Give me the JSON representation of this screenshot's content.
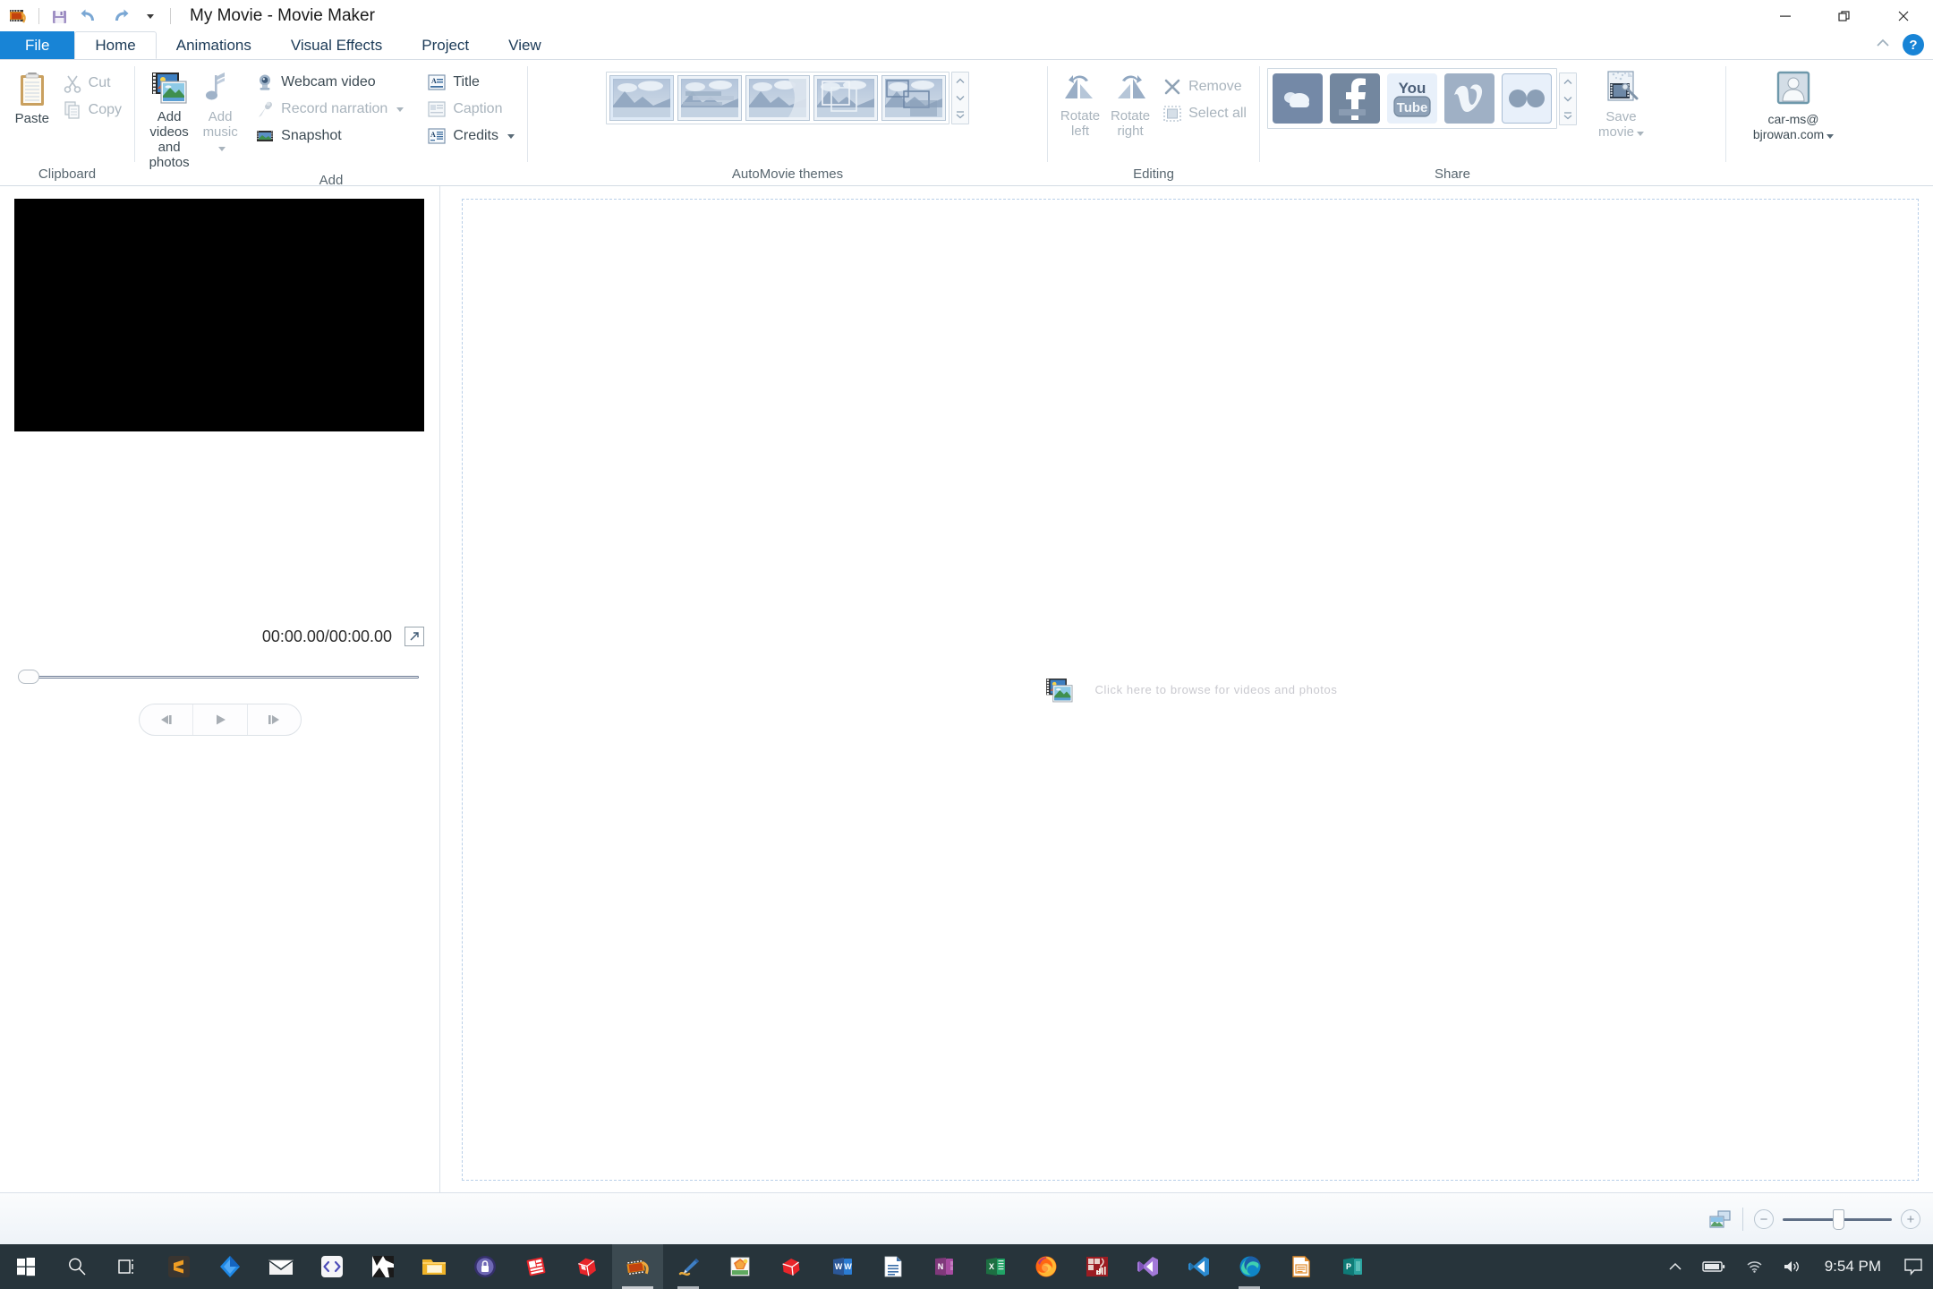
{
  "window": {
    "title": "My Movie - Movie Maker",
    "app_icon": "movie-maker-icon",
    "quick_access": [
      {
        "name": "save-icon",
        "label": "Save"
      },
      {
        "name": "undo-icon",
        "label": "Undo"
      },
      {
        "name": "redo-icon",
        "label": "Redo"
      },
      {
        "name": "customize-qat-icon",
        "label": "Customize Quick Access Toolbar"
      }
    ],
    "controls": [
      {
        "name": "minimize-button",
        "label": "Minimize",
        "glyph": "minimize"
      },
      {
        "name": "restore-button",
        "label": "Restore",
        "glyph": "restore"
      },
      {
        "name": "close-button",
        "label": "Close",
        "glyph": "close"
      }
    ]
  },
  "tabs": [
    {
      "label": "File",
      "kind": "file"
    },
    {
      "label": "Home",
      "kind": "active"
    },
    {
      "label": "Animations",
      "kind": "normal"
    },
    {
      "label": "Visual Effects",
      "kind": "normal"
    },
    {
      "label": "Project",
      "kind": "normal"
    },
    {
      "label": "View",
      "kind": "normal"
    }
  ],
  "tabstrip_right": {
    "collapse_label": "Minimize the Ribbon",
    "help_label": "?"
  },
  "ribbon": {
    "groups": [
      {
        "id": "clipboard",
        "label": "Clipboard",
        "big": [
          {
            "name": "paste-button",
            "label": "Paste",
            "icon": "clipboard-icon",
            "disabled": false
          }
        ],
        "small": [
          {
            "name": "cut-button",
            "label": "Cut",
            "icon": "scissors-icon",
            "disabled": true
          },
          {
            "name": "copy-button",
            "label": "Copy",
            "icon": "copy-icon",
            "disabled": true
          }
        ]
      },
      {
        "id": "add",
        "label": "Add",
        "big": [
          {
            "name": "add-videos-and-photos-button",
            "label1": "Add videos",
            "label2": "and photos",
            "icon": "add-media-icon",
            "disabled": false
          },
          {
            "name": "add-music-button",
            "label1": "Add",
            "label2": "music",
            "icon": "music-note-icon",
            "disabled": true,
            "caret": true
          }
        ],
        "small": [
          {
            "name": "webcam-video-button",
            "label": "Webcam video",
            "icon": "webcam-icon",
            "disabled": false
          },
          {
            "name": "record-narration-button",
            "label": "Record narration",
            "icon": "microphone-icon",
            "disabled": true,
            "caret": true
          },
          {
            "name": "snapshot-button",
            "label": "Snapshot",
            "icon": "snapshot-icon",
            "disabled": false
          }
        ],
        "small2": [
          {
            "name": "title-button",
            "label": "Title",
            "icon": "title-icon",
            "disabled": false
          },
          {
            "name": "caption-button",
            "label": "Caption",
            "icon": "caption-icon",
            "disabled": true
          },
          {
            "name": "credits-button",
            "label": "Credits",
            "icon": "credits-icon",
            "disabled": false,
            "caret": true
          }
        ]
      },
      {
        "id": "automovie-themes",
        "label": "AutoMovie themes",
        "themes": [
          {
            "name": "theme-no-theme",
            "label": "No theme",
            "style": "plain"
          },
          {
            "name": "theme-default",
            "label": "Default",
            "style": "bars"
          },
          {
            "name": "theme-contemporary",
            "label": "Contemporary",
            "style": "curve"
          },
          {
            "name": "theme-cinematic",
            "label": "Cinematic",
            "style": "frames"
          },
          {
            "name": "theme-fade",
            "label": "Fade",
            "style": "boxes"
          }
        ],
        "scroll": [
          {
            "name": "gallery-scroll-up-button",
            "glyph": "up"
          },
          {
            "name": "gallery-scroll-down-button",
            "glyph": "down"
          },
          {
            "name": "gallery-more-button",
            "glyph": "more"
          }
        ]
      },
      {
        "id": "editing",
        "label": "Editing",
        "big": [
          {
            "name": "rotate-left-button",
            "label1": "Rotate",
            "label2": "left",
            "icon": "rotate-left-icon",
            "disabled": true
          },
          {
            "name": "rotate-right-button",
            "label1": "Rotate",
            "label2": "right",
            "icon": "rotate-right-icon",
            "disabled": true
          }
        ],
        "small": [
          {
            "name": "remove-button",
            "label": "Remove",
            "icon": "remove-x-icon",
            "disabled": true
          },
          {
            "name": "select-all-button",
            "label": "Select all",
            "icon": "select-all-icon",
            "disabled": true
          }
        ]
      },
      {
        "id": "share",
        "label": "Share",
        "services": [
          {
            "name": "onedrive-share-button",
            "label": "OneDrive",
            "style": "onedrive"
          },
          {
            "name": "facebook-share-button",
            "label": "Facebook",
            "style": "facebook"
          },
          {
            "name": "youtube-share-button",
            "label": "YouTube",
            "style": "youtube"
          },
          {
            "name": "vimeo-share-button",
            "label": "Vimeo",
            "style": "vimeo"
          },
          {
            "name": "flickr-share-button",
            "label": "Flickr",
            "style": "flickr"
          }
        ],
        "scroll": [
          {
            "name": "share-scroll-up-button",
            "glyph": "up"
          },
          {
            "name": "share-scroll-down-button",
            "glyph": "down"
          },
          {
            "name": "share-more-button",
            "glyph": "more"
          }
        ],
        "save_movie": {
          "name": "save-movie-button",
          "label1": "Save",
          "label2": "movie",
          "icon": "save-movie-icon",
          "disabled": true,
          "caret": true
        }
      }
    ],
    "account": {
      "name": "account-button",
      "icon": "user-avatar-icon",
      "line1": "car-ms@",
      "line2": "bjrowan.com",
      "caret": true
    }
  },
  "preview": {
    "timecode": "00:00.00/00:00.00",
    "fullscreen_label": "View full screen",
    "scrub_label": "Seek",
    "transport": [
      {
        "name": "previous-frame-button",
        "label": "Previous frame",
        "glyph": "prev"
      },
      {
        "name": "play-button",
        "label": "Play",
        "glyph": "play"
      },
      {
        "name": "next-frame-button",
        "label": "Next frame",
        "glyph": "next"
      }
    ]
  },
  "storyboard": {
    "drop_icon": "add-media-icon",
    "drop_text": "Click here to browse for videos and photos"
  },
  "statusbar": {
    "view_toggle": {
      "name": "thumbnail-view-button",
      "label": "Storyboard view"
    },
    "zoom_out": {
      "name": "zoom-out-button",
      "label": "−"
    },
    "zoom_in": {
      "name": "zoom-in-button",
      "label": "+"
    },
    "zoom_slider_label": "Zoom timeline"
  },
  "taskbar": {
    "start": {
      "name": "start-button",
      "label": "Start"
    },
    "search": {
      "name": "search-button",
      "label": "Search"
    },
    "taskview": {
      "name": "task-view-button",
      "label": "Task View"
    },
    "apps": [
      {
        "name": "taskbar-sublime-text",
        "label": "Sublime Text",
        "style": "sublime"
      },
      {
        "name": "taskbar-jetbrains",
        "label": "JetBrains Toolbox",
        "style": "jetbrains"
      },
      {
        "name": "taskbar-mail",
        "label": "Mail",
        "style": "mail"
      },
      {
        "name": "taskbar-code-editor",
        "label": "Code Editor",
        "style": "codeeditor"
      },
      {
        "name": "taskbar-blackwhite-app",
        "label": "Design App",
        "style": "bwapp"
      },
      {
        "name": "taskbar-file-explorer",
        "label": "File Explorer",
        "style": "explorer"
      },
      {
        "name": "taskbar-keepass",
        "label": "KeePass",
        "style": "keepass"
      },
      {
        "name": "taskbar-publisher",
        "label": "Publisher",
        "style": "pubred"
      },
      {
        "name": "taskbar-3dbox-app",
        "label": "3D Box App",
        "style": "boxred"
      },
      {
        "name": "taskbar-movie-maker",
        "label": "Movie Maker",
        "style": "moviemaker",
        "state": "running"
      },
      {
        "name": "taskbar-paint",
        "label": "Paint",
        "style": "paint",
        "state": "minimized"
      },
      {
        "name": "taskbar-photo-gallery",
        "label": "Photo Gallery",
        "style": "photogallery"
      },
      {
        "name": "taskbar-sketchup",
        "label": "SketchUp",
        "style": "sketchup"
      },
      {
        "name": "taskbar-word",
        "label": "Word",
        "style": "word"
      },
      {
        "name": "taskbar-wordpad",
        "label": "WordPad",
        "style": "wordpad"
      },
      {
        "name": "taskbar-onenote",
        "label": "OneNote",
        "style": "onenote"
      },
      {
        "name": "taskbar-excel",
        "label": "Excel",
        "style": "excel"
      },
      {
        "name": "taskbar-firefox",
        "label": "Firefox",
        "style": "firefox"
      },
      {
        "name": "taskbar-musescore",
        "label": "MuseScore",
        "style": "musescore"
      },
      {
        "name": "taskbar-visual-studio",
        "label": "Visual Studio",
        "style": "vs"
      },
      {
        "name": "taskbar-vscode",
        "label": "Visual Studio Code",
        "style": "vscode"
      },
      {
        "name": "taskbar-edge",
        "label": "Microsoft Edge",
        "style": "edge",
        "state": "minimized"
      },
      {
        "name": "taskbar-libreoffice-impress",
        "label": "LibreOffice Impress",
        "style": "impress"
      },
      {
        "name": "taskbar-publisher-teal",
        "label": "Publisher",
        "style": "pubteal"
      }
    ],
    "tray": [
      {
        "name": "show-hidden-icons-button",
        "label": "Show hidden icons",
        "glyph": "chevron-up"
      },
      {
        "name": "battery-icon",
        "label": "Battery",
        "glyph": "battery"
      },
      {
        "name": "network-icon",
        "label": "Network",
        "glyph": "wifi"
      },
      {
        "name": "volume-icon",
        "label": "Volume",
        "glyph": "speaker"
      }
    ],
    "clock": {
      "name": "clock",
      "time": "9:54 PM"
    },
    "action_center": {
      "name": "action-center-button",
      "label": "Notifications"
    }
  }
}
